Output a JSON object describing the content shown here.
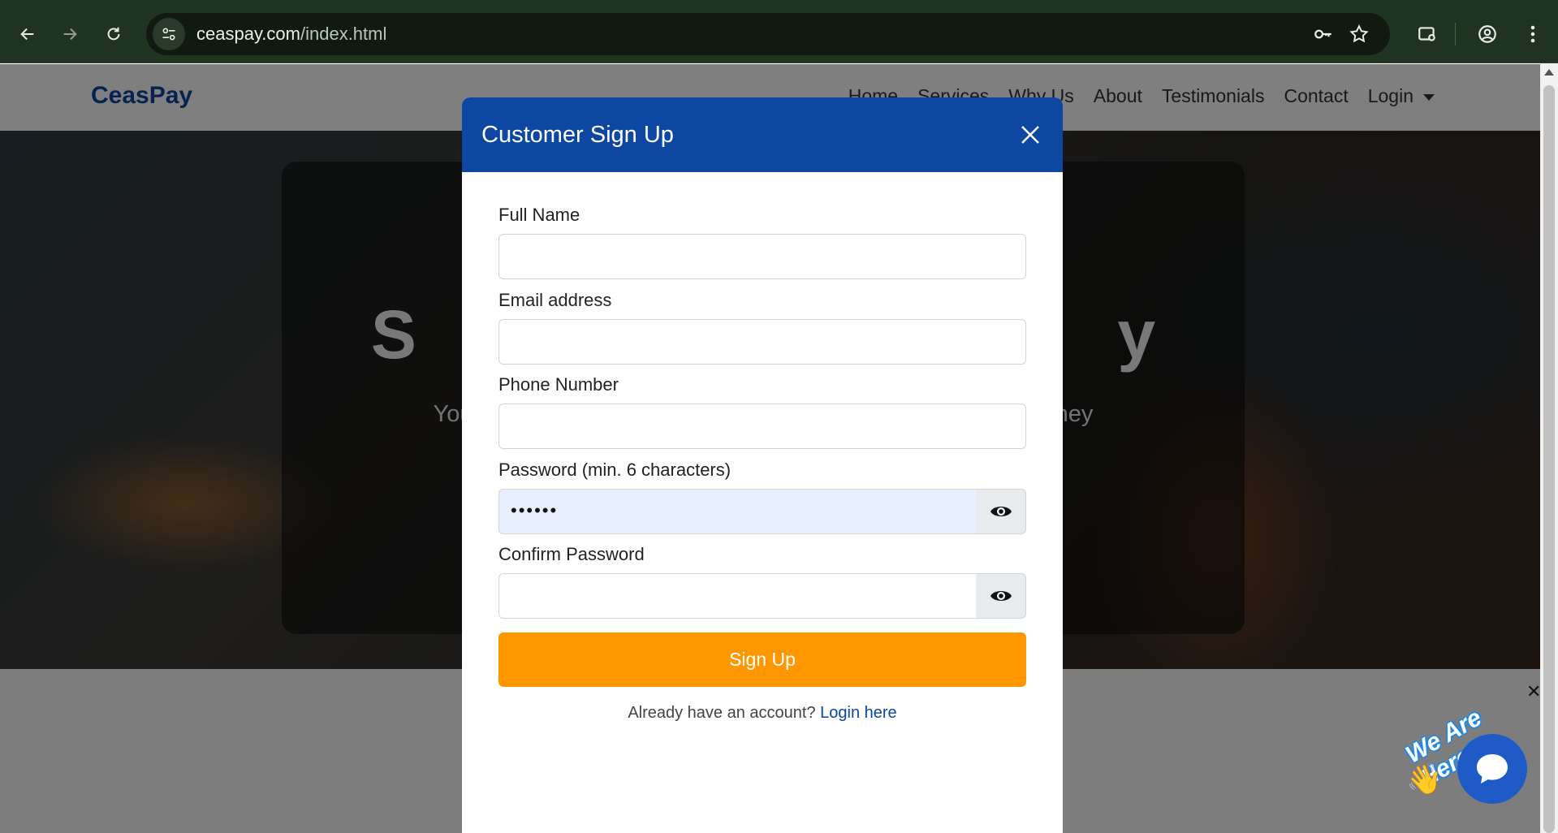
{
  "browser": {
    "url_domain": "ceaspay.com",
    "url_path": "/index.html"
  },
  "site": {
    "brand": "CeasPay",
    "nav": [
      "Home",
      "Services",
      "Why Us",
      "About",
      "Testimonials",
      "Contact",
      "Login"
    ]
  },
  "hero": {
    "title": "S                                     y",
    "subtitle": "Your trus                                                                        s, money"
  },
  "modal": {
    "title": "Customer Sign Up",
    "fields": {
      "full_name_label": "Full Name",
      "email_label": "Email address",
      "phone_label": "Phone Number",
      "password_label": "Password (min. 6 characters)",
      "password_value": "••••••",
      "confirm_label": "Confirm Password"
    },
    "submit_label": "Sign Up",
    "login_prompt": "Already have an account?",
    "login_link": "Login here"
  },
  "chat_widget": {
    "badge": "We Are Here!",
    "wave": "👋",
    "close": "✕"
  },
  "colors": {
    "brand_blue": "#0d47a1",
    "accent_orange": "#ff9800",
    "chrome_green": "#1f3320"
  }
}
